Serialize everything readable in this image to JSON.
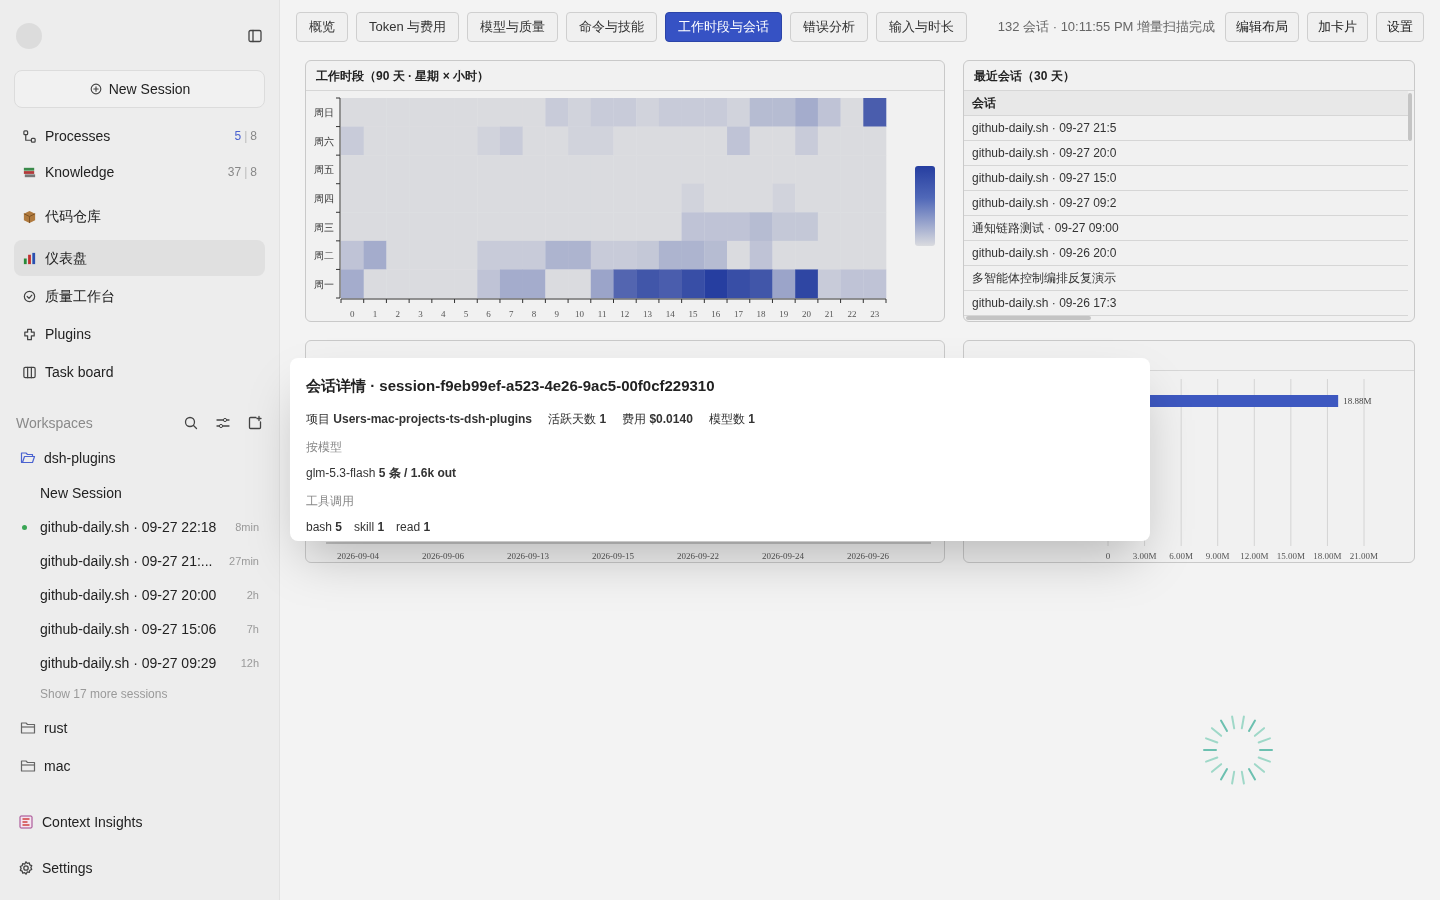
{
  "sidebar": {
    "new_session": "New Session",
    "nav": [
      {
        "label": "Processes",
        "count_main": "5",
        "count_sep": "|",
        "count_total": "8",
        "count_highlight": true,
        "selected": false
      },
      {
        "label": "Knowledge",
        "count_main": "37",
        "count_sep": "|",
        "count_total": "8",
        "count_highlight": false,
        "selected": false
      },
      {
        "label": "代码仓库",
        "selected": false
      },
      {
        "label": "仪表盘",
        "selected": true
      },
      {
        "label": "质量工作台",
        "selected": false
      },
      {
        "label": "Plugins",
        "selected": false
      },
      {
        "label": "Task board",
        "selected": false
      }
    ],
    "workspaces": {
      "title": "Workspaces",
      "projects": [
        {
          "name": "dsh-plugins",
          "expanded": true,
          "sessions": [
            {
              "title": "New Session",
              "active": false
            },
            {
              "title": "github-daily.sh · 09-27 22:18",
              "age": "8min",
              "active": true
            },
            {
              "title": "github-daily.sh · 09-27 21:...",
              "age": "27min",
              "active": false
            },
            {
              "title": "github-daily.sh · 09-27 20:00",
              "age": "2h",
              "active": false
            },
            {
              "title": "github-daily.sh · 09-27 15:06",
              "age": "7h",
              "active": false
            },
            {
              "title": "github-daily.sh · 09-27 09:29",
              "age": "12h",
              "active": false
            }
          ],
          "more": "Show 17 more sessions"
        },
        {
          "name": "rust",
          "expanded": false
        },
        {
          "name": "mac",
          "expanded": false
        }
      ]
    },
    "footer": [
      "Context Insights",
      "Settings"
    ]
  },
  "tabs": [
    {
      "label": "概览",
      "selected": false
    },
    {
      "label": "Token 与费用",
      "selected": false
    },
    {
      "label": "模型与质量",
      "selected": false
    },
    {
      "label": "命令与技能",
      "selected": false
    },
    {
      "label": "工作时段与会话",
      "selected": true
    },
    {
      "label": "错误分析",
      "selected": false
    },
    {
      "label": "输入与时长",
      "selected": false
    }
  ],
  "status": "132 会话 · 10:11:55 PM 增量扫描完成",
  "toolbar_buttons": [
    "编辑布局",
    "加卡片",
    "设置"
  ],
  "heatmap_panel": {
    "title": "工作时段（90 天 · 星期 × 小时）",
    "rows": [
      "周日",
      "周六",
      "周五",
      "周四",
      "周三",
      "周二",
      "周一"
    ],
    "columns": [
      "0",
      "1",
      "2",
      "3",
      "4",
      "5",
      "6",
      "7",
      "8",
      "9",
      "10",
      "11",
      "12",
      "13",
      "14",
      "15",
      "16",
      "17",
      "18",
      "19",
      "20",
      "21",
      "22",
      "23"
    ]
  },
  "recent_panel": {
    "title": "最近会话（30 天）",
    "column": "会话",
    "rows": [
      "github-daily.sh · 09-27 21:5",
      "github-daily.sh · 09-27 20:0",
      "github-daily.sh · 09-27 15:0",
      "github-daily.sh · 09-27 09:2",
      "通知链路测试 · 09-27 09:00",
      "github-daily.sh · 09-26 20:0",
      "多智能体控制编排反复演示",
      "github-daily.sh · 09-26 17:3"
    ]
  },
  "daily_panel": {
    "x_labels": [
      "2026-09-04",
      "2026-09-06",
      "2026-09-13",
      "2026-09-15",
      "2026-09-22",
      "2026-09-24",
      "2026-09-26"
    ]
  },
  "project_panel": {
    "chart_data": {
      "type": "bar",
      "orientation": "horizontal",
      "grid": true,
      "values": [
        18.88
      ],
      "value_labels": [
        "18.88M"
      ],
      "xlim": [
        0,
        21
      ],
      "xticks": [
        {
          "value": 0,
          "label": "0"
        },
        {
          "value": 3,
          "label": "3.00M"
        },
        {
          "value": 6,
          "label": "6.00M"
        },
        {
          "value": 9,
          "label": "9.00M"
        },
        {
          "value": 12,
          "label": "12.00M"
        },
        {
          "value": 15,
          "label": "15.00M"
        },
        {
          "value": 18,
          "label": "18.00M"
        },
        {
          "value": 21,
          "label": "21.00M"
        }
      ]
    }
  },
  "modal": {
    "title": "会话详情 · session-f9eb99ef-a523-4e26-9ac5-00f0cf229310",
    "meta": [
      "项目 **Users-mac-projects-ts-dsh-plugins**",
      "活跃天数 **1**",
      "费用 **$0.0140**",
      "模型数 **1**"
    ],
    "sections": [
      {
        "heading": "按模型",
        "items": [
          "glm-5.3-flash **5 条 / 1.6k out**"
        ]
      },
      {
        "heading": "工具调用",
        "items": [
          "bash **5**",
          "skill **1**",
          "read **1**"
        ]
      }
    ]
  }
}
